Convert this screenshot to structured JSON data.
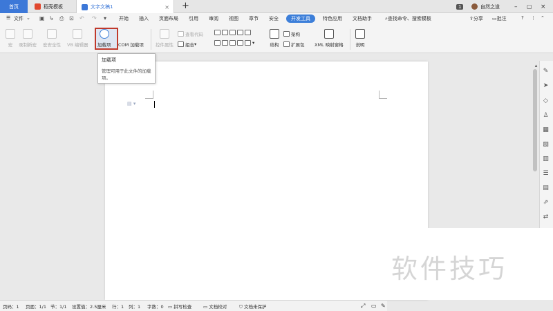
{
  "tabs": {
    "home": "首页",
    "doc1": "稻壳模板",
    "doc2": "文字文稿1",
    "add": "+"
  },
  "titlebar_right": {
    "badge": "1",
    "user": "自然之道"
  },
  "menu": {
    "file": "文件",
    "items": [
      "开始",
      "插入",
      "页面布局",
      "引用",
      "审阅",
      "视图",
      "章节",
      "安全",
      "开发工具",
      "特色应用",
      "文档助手"
    ],
    "search": "查找命令、搜索模板",
    "share": "分享",
    "comment": "批注",
    "help": "?"
  },
  "ribbon": {
    "macro": "宏",
    "record_macro": "录制新宏",
    "macro_security": "宏安全性",
    "vb_editor": "VB 编辑器",
    "addins": "加载项",
    "com_addins": "COM 加载项",
    "control_props": "控件属性",
    "view_code": "查看代码",
    "group": "组合",
    "structure": "结构",
    "schema": "架构",
    "expansion_pack": "扩展包",
    "xml_mapping": "XML 映射窗格",
    "explanation": "说明"
  },
  "tooltip": {
    "title": "加载项",
    "description": "管理可用于此文件的加载项。"
  },
  "statusbar": {
    "page_num": "页码：1",
    "pages": "页面：1/1",
    "section": "节：1/1",
    "setting": "设置值：2.5厘米",
    "row": "行：1",
    "col": "列：1",
    "word_count": "字数：0",
    "spell_check": "拼写检查",
    "doc_proof": "文档校对",
    "doc_unprotected": "文档未保护"
  },
  "watermark": "软件技巧",
  "colors": {
    "accent": "#3d7fd9",
    "home_tab": "#3c78d8",
    "highlight_border": "#c0392b"
  }
}
